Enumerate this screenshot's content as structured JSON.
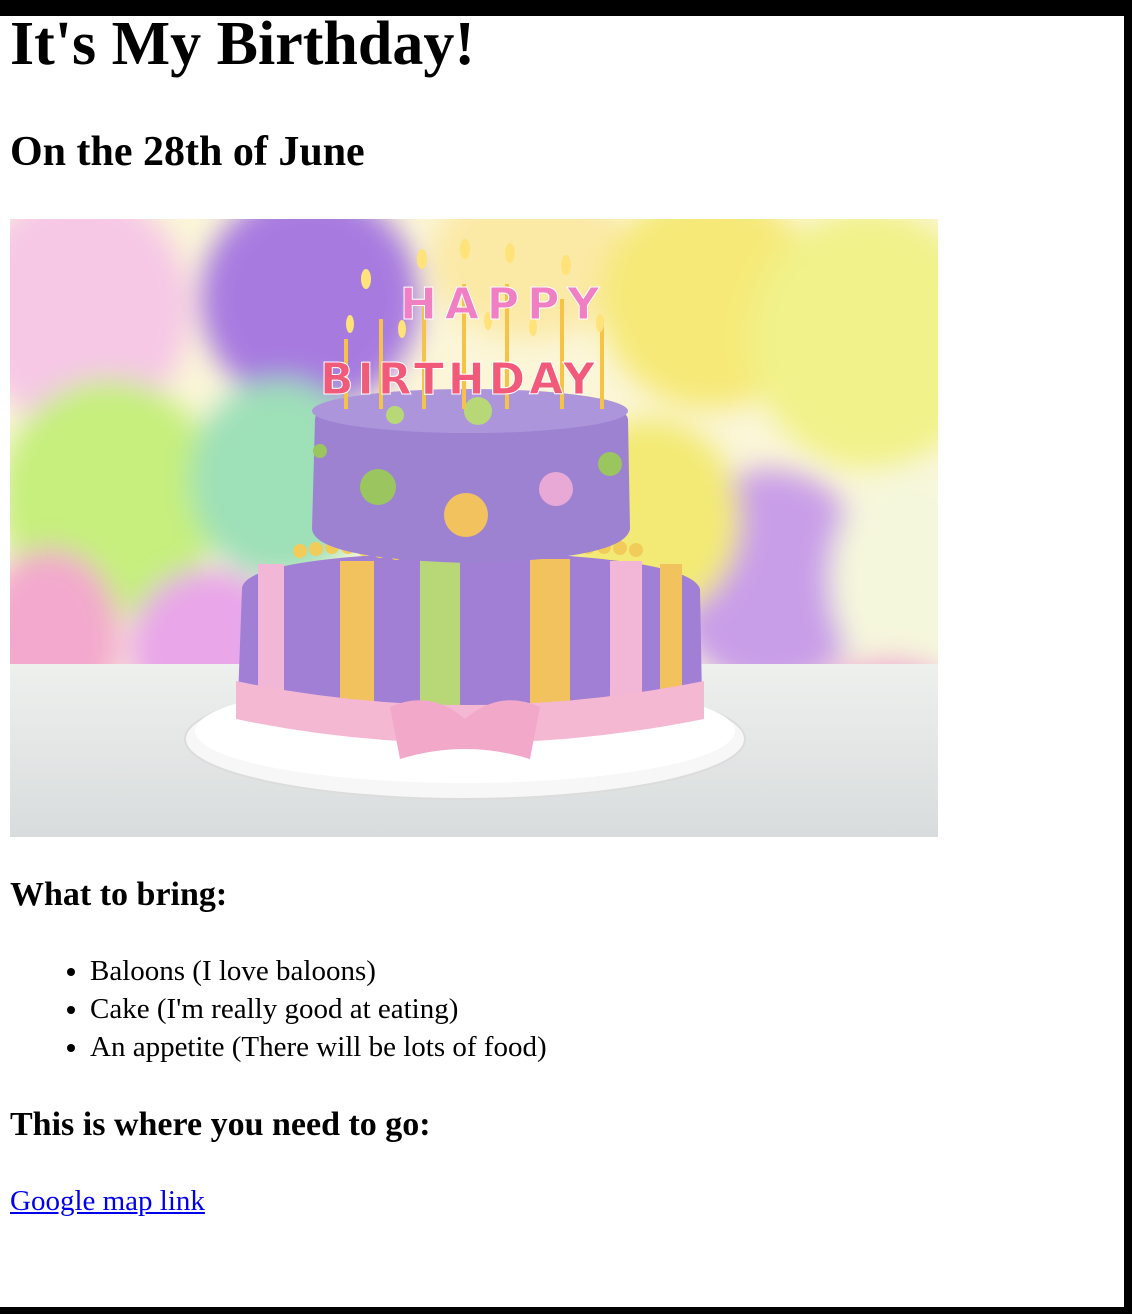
{
  "page": {
    "title": "It's My Birthday!",
    "subtitle": "On the 28th of June",
    "image": {
      "alt": "Two-tier birthday cake with Happy Birthday candles",
      "candle_text_top": "HAPPY",
      "candle_text_bottom": "BIRTHDAY"
    },
    "bring": {
      "heading": "What to bring:",
      "items": [
        "Baloons (I love baloons)",
        "Cake (I'm really good at eating)",
        "An appetite (There will be lots of food)"
      ]
    },
    "location": {
      "heading": "This is where you need to go:",
      "link_text": "Google map link"
    }
  },
  "colors": {
    "link": "#0000ee",
    "frame": "#000000",
    "background": "#ffffff"
  }
}
